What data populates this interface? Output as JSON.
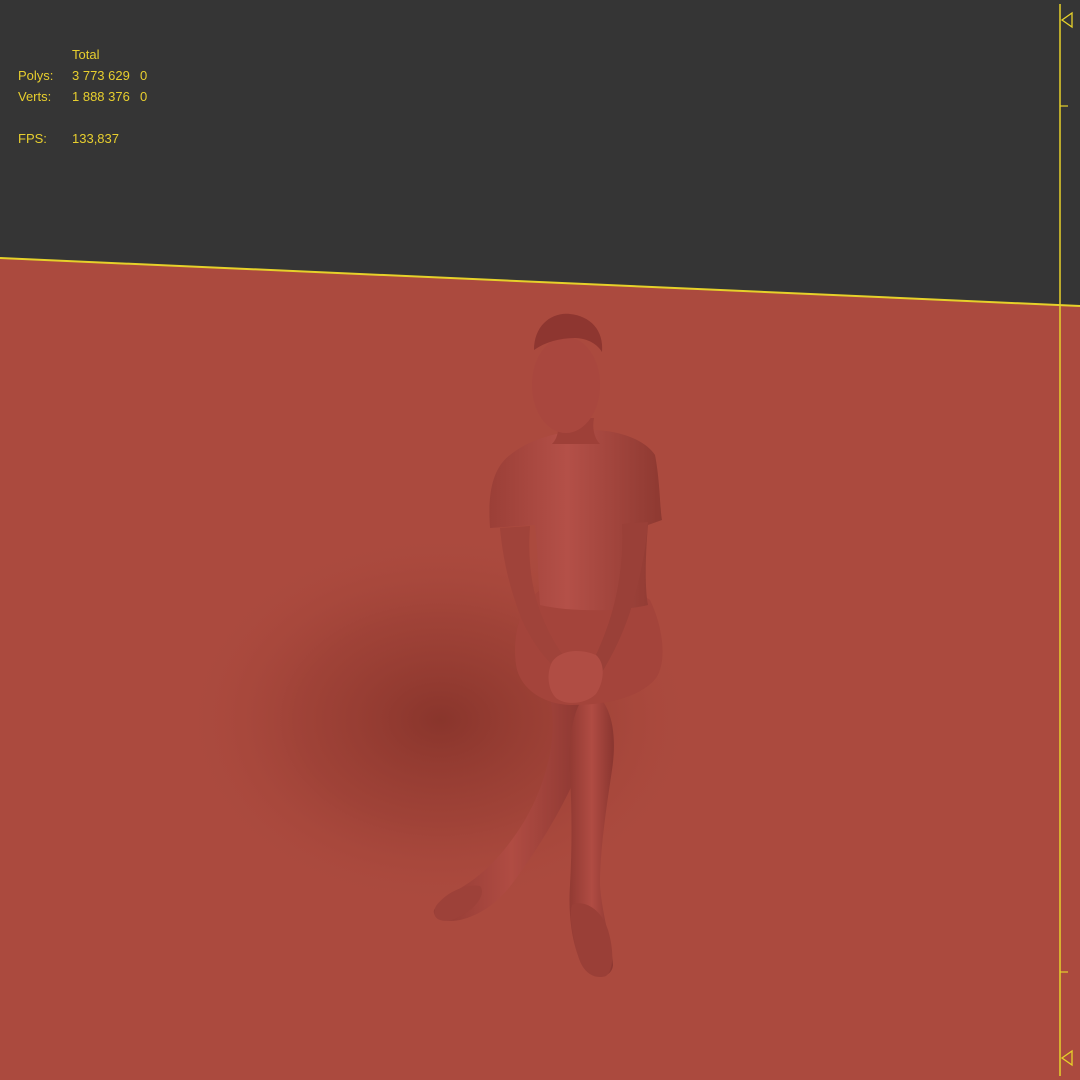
{
  "viewport": {
    "stats": {
      "header": "Total",
      "polys_label": "Polys:",
      "polys_total": "3 773 629",
      "polys_selected": "0",
      "verts_label": "Verts:",
      "verts_total": "1 888 376",
      "verts_selected": "0",
      "fps_label": "FPS:",
      "fps_value": "133,837"
    },
    "colors": {
      "background": "#353535",
      "ground_plane": "#ab4a3e",
      "model": "#a8463d",
      "horizon_line": "#e6d12a",
      "stats_text": "#e8cf2e"
    }
  }
}
